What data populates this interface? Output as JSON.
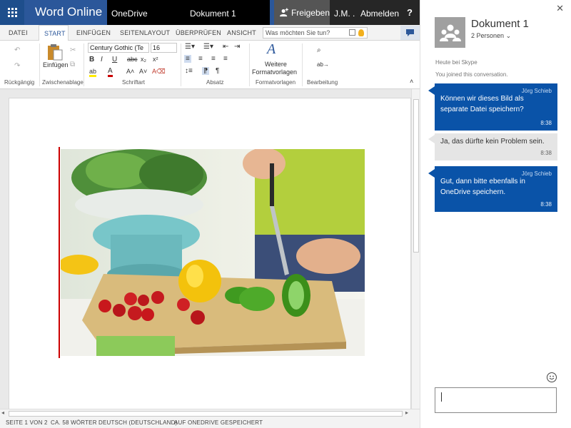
{
  "topbar": {
    "app_title": "Word Online",
    "onedrive_label": "OneDrive",
    "document_title": "Dokument 1",
    "share_label": "Freigeben",
    "user_name": "J.M. .",
    "signout_label": "Abmelden",
    "help_label": "?",
    "accent_color": "#2b579a"
  },
  "tabs": {
    "items": [
      {
        "label": "DATEI"
      },
      {
        "label": "START",
        "active": true
      },
      {
        "label": "EINFÜGEN"
      },
      {
        "label": "SEITENLAYOUT"
      },
      {
        "label": "ÜBERPRÜFEN"
      },
      {
        "label": "ANSICHT"
      }
    ],
    "tell_me_placeholder": "Was möchten Sie tun?"
  },
  "ribbon": {
    "undo_group_label": "Rückgängig",
    "clipboard_group_label": "Zwischenablage",
    "paste_label": "Einfügen",
    "font_group_label": "Schriftart",
    "font_name": "Century Gothic (Te",
    "font_size": "16",
    "paragraph_group_label": "Absatz",
    "styles_group_label": "Formatvorlagen",
    "more_styles_label_1": "Weitere",
    "more_styles_label_2": "Formatvorlagen",
    "editing_group_label": "Bearbeitung"
  },
  "statusbar": {
    "page": "SEITE 1 VON 2",
    "words": "CA. 58 WÖRTER",
    "language": "DEUTSCH (DEUTSCHLAND)",
    "saved": "AUF ONEDRIVE GESPEICHERT"
  },
  "skype": {
    "conversation_title": "Dokument 1",
    "people_label": "2 Personen",
    "date_label": "Heute bei Skype",
    "joined_label": "You joined this conversation.",
    "messages": [
      {
        "sender": "Jörg Schieb",
        "text": "Können wir dieses Bild als separate Datei speichern?",
        "time": "8:38",
        "direction": "incoming"
      },
      {
        "sender": "",
        "text": "Ja, das dürfte kein Problem sein.",
        "time": "8:38",
        "direction": "outgoing"
      },
      {
        "sender": "Jörg Schieb",
        "text": "Gut, dann bitte ebenfalls in OneDrive speichern.",
        "time": "8:38",
        "direction": "incoming"
      }
    ],
    "incoming_color": "#0a53a8",
    "outgoing_color": "#e5e5e5"
  }
}
